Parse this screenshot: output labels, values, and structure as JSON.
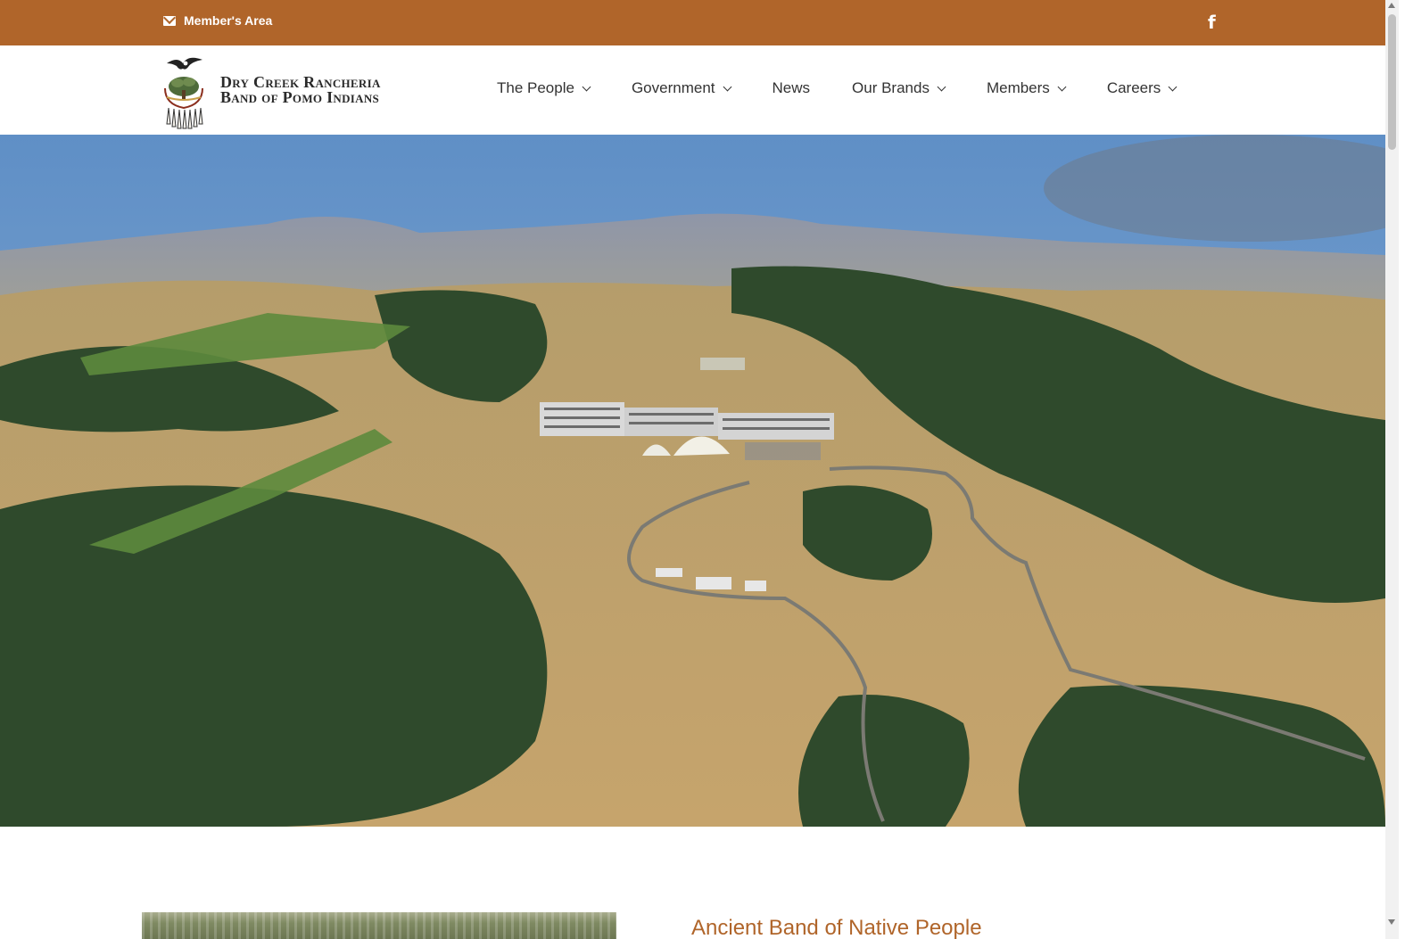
{
  "topbar": {
    "member_area_label": "Member's Area",
    "background": "#b0652a",
    "icons": {
      "member": "envelope-icon",
      "social": "facebook-icon"
    },
    "facebook_glyph": "f"
  },
  "header": {
    "logo": {
      "line1": "Dry Creek Rancheria",
      "line2": "Band of Pomo Indians",
      "emblem": "eagle-oak-emblem"
    },
    "nav": [
      {
        "label": "The People",
        "dropdown": true
      },
      {
        "label": "Government",
        "dropdown": true
      },
      {
        "label": "News",
        "dropdown": false
      },
      {
        "label": "Our Brands",
        "dropdown": true
      },
      {
        "label": "Members",
        "dropdown": true
      },
      {
        "label": "Careers",
        "dropdown": true
      }
    ]
  },
  "hero": {
    "image": "aerial view of hilltop resort among golden oak-covered hills"
  },
  "intro": {
    "heading": "Ancient Band of Native People",
    "accent_color": "#b0652a"
  }
}
